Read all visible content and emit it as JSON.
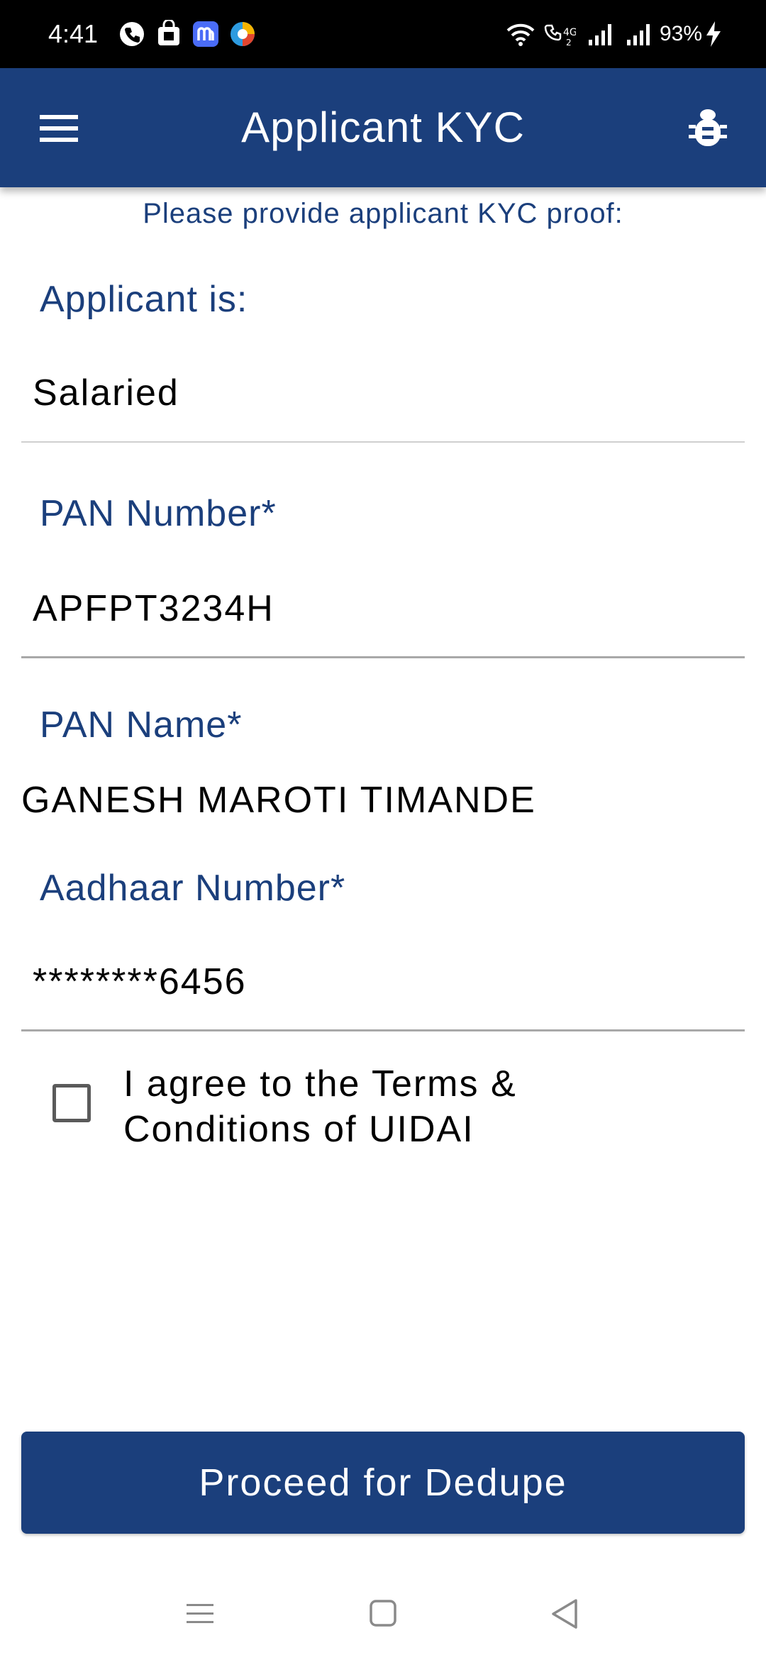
{
  "status_bar": {
    "time": "4:41",
    "battery": "93%",
    "icons": [
      "phone-icon",
      "store-icon",
      "messenger-icon",
      "browser-icon",
      "wifi-icon",
      "volte-icon",
      "signal-icon",
      "signal-icon",
      "charging-icon"
    ]
  },
  "app_bar": {
    "title": "Applicant KYC",
    "menu_icon": "hamburger-menu-icon",
    "action_icon": "bug-icon"
  },
  "form": {
    "subtitle": "Please provide applicant KYC proof:",
    "applicant_is": {
      "label": "Applicant is:",
      "value": "Salaried"
    },
    "pan_number": {
      "label": "PAN Number*",
      "value": "APFPT3234H"
    },
    "pan_name": {
      "label": "PAN Name*",
      "value": "GANESH MAROTI TIMANDE"
    },
    "aadhaar_number": {
      "label": "Aadhaar Number*",
      "value": "********6456"
    },
    "terms": {
      "label": "I agree to the Terms & Conditions of UIDAI",
      "checked": false
    }
  },
  "actions": {
    "proceed_label": "Proceed for Dedupe"
  },
  "colors": {
    "primary": "#1b3f7c",
    "status_bar": "#000000",
    "divider": "#a8a8a8"
  },
  "nav_bar": {
    "buttons": [
      "recents-icon",
      "home-icon",
      "back-icon"
    ]
  }
}
